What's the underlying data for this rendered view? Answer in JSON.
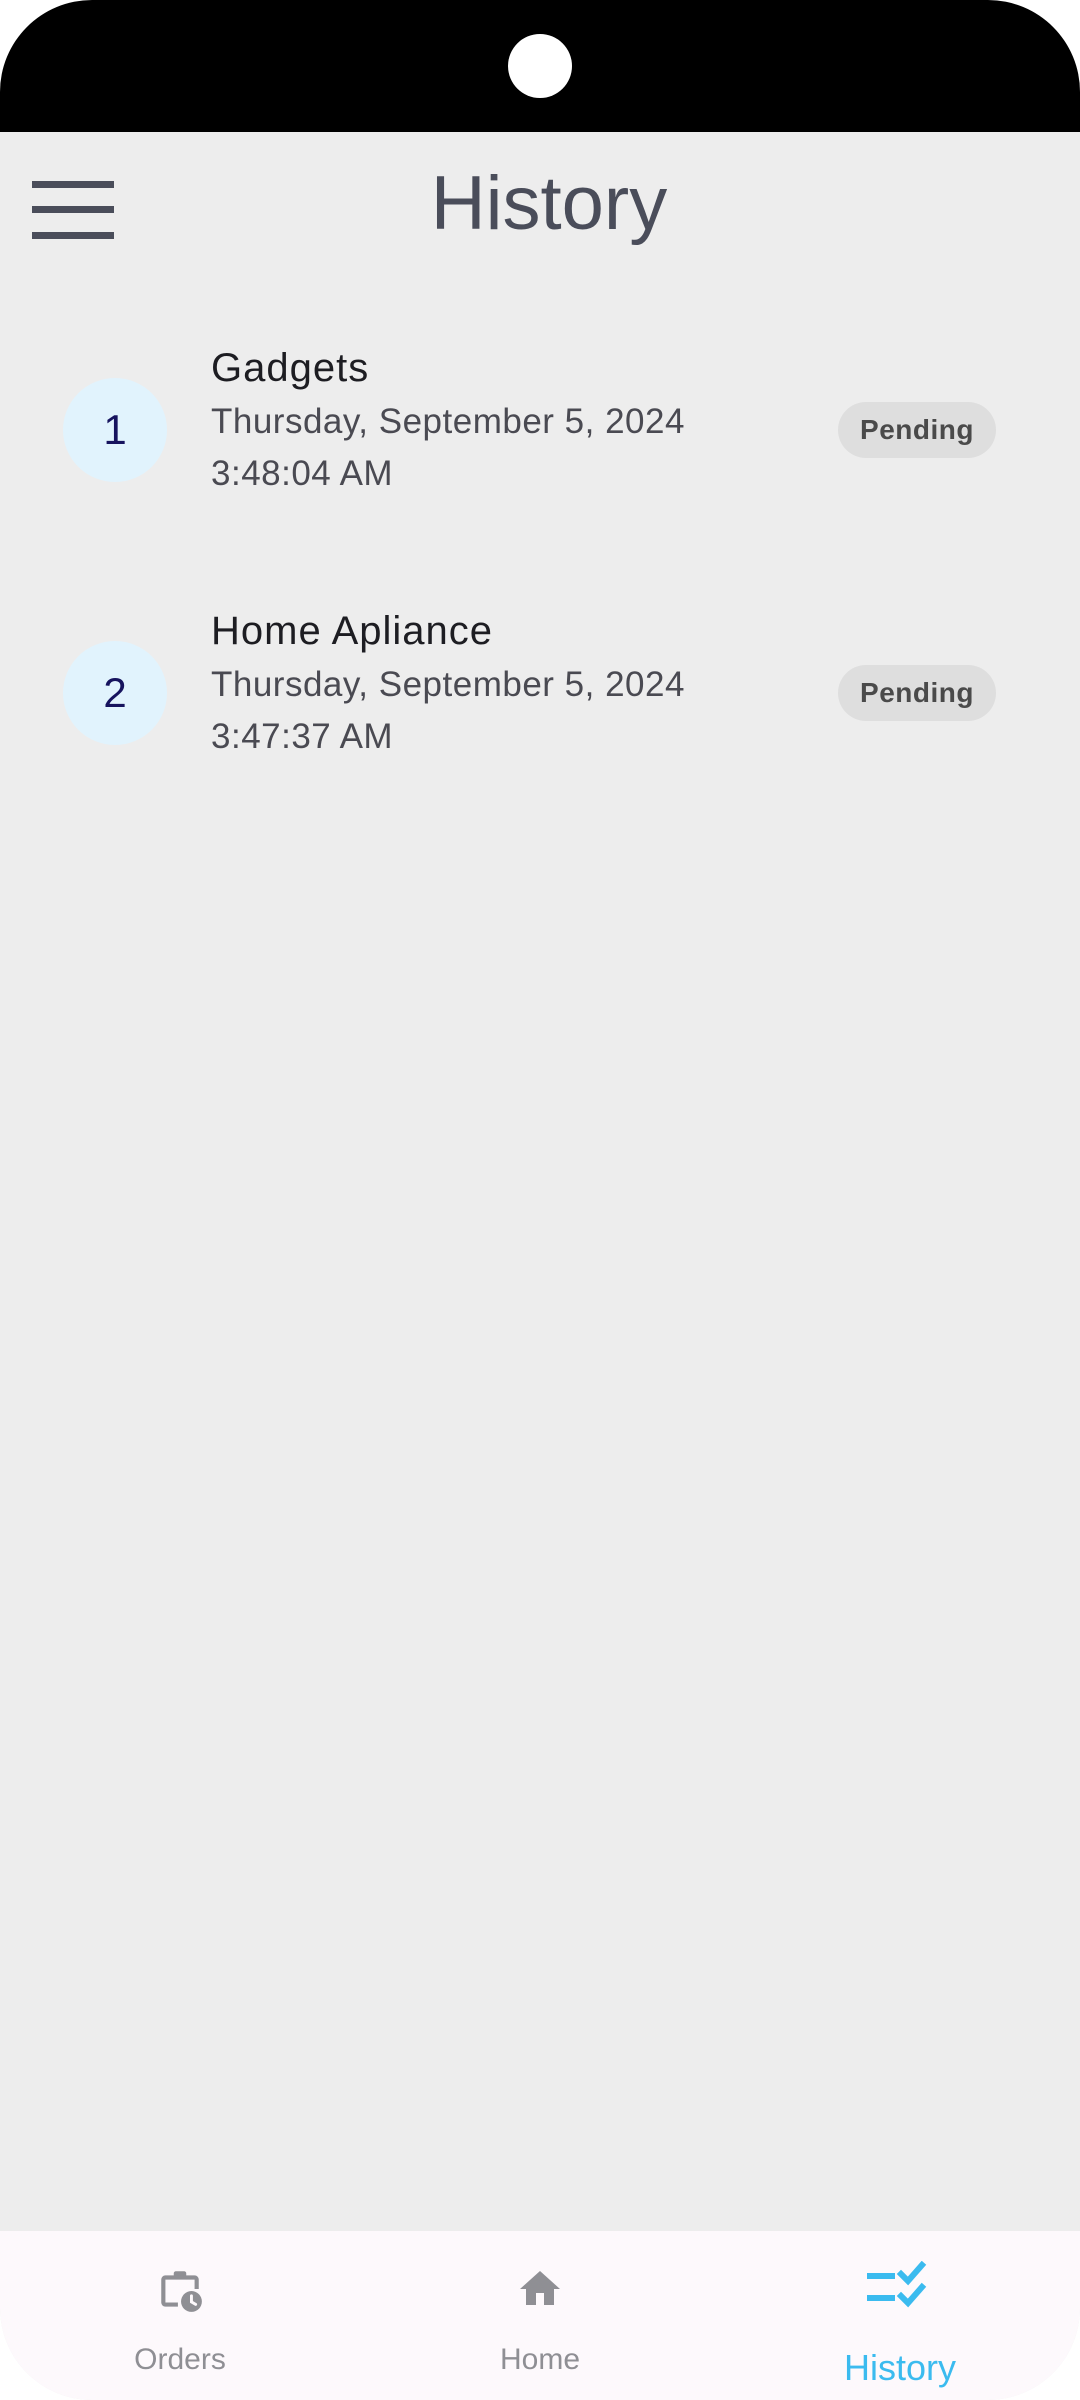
{
  "app_bar": {
    "title": "History",
    "menu_icon": "hamburger-menu-icon"
  },
  "history_items": [
    {
      "index": "1",
      "title": "Gadgets",
      "date": "Thursday, September 5, 2024",
      "time": "3:48:04 AM",
      "status": "Pending"
    },
    {
      "index": "2",
      "title": "Home Apliance",
      "date": "Thursday, September 5, 2024",
      "time": "3:47:37 AM",
      "status": "Pending"
    }
  ],
  "bottom_nav": {
    "items": [
      {
        "label": "Orders",
        "icon": "briefcase-clock-icon",
        "active": false
      },
      {
        "label": "Home",
        "icon": "home-icon",
        "active": false
      },
      {
        "label": "History",
        "icon": "checklist-icon",
        "active": true
      }
    ]
  },
  "colors": {
    "background": "#ededed",
    "accent": "#3bbbef",
    "avatar_bg": "#e1f3fd",
    "avatar_text": "#16135e",
    "chip_bg": "#dedede",
    "title_text": "#4a4d5a",
    "inactive_nav": "#8f8f94"
  }
}
